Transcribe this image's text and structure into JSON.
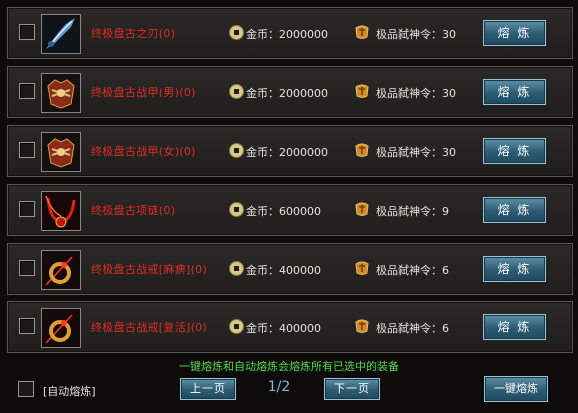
{
  "items": [
    {
      "name": "终极盘古之刃(0)",
      "gold_label": "金币：2000000",
      "token_label": "极品弑神令：30",
      "button_label": "熔 炼",
      "icon": "blue-blade-icon"
    },
    {
      "name": "终极盘古战甲(男)(0)",
      "gold_label": "金币：2000000",
      "token_label": "极品弑神令：30",
      "button_label": "熔 炼",
      "icon": "armor-male-icon"
    },
    {
      "name": "终极盘古战甲(女)(0)",
      "gold_label": "金币：2000000",
      "token_label": "极品弑神令：30",
      "button_label": "熔 炼",
      "icon": "armor-female-icon"
    },
    {
      "name": "终极盘古项链(0)",
      "gold_label": "金币：600000",
      "token_label": "极品弑神令：9",
      "button_label": "熔 炼",
      "icon": "necklace-icon"
    },
    {
      "name": "终极盘古战戒[麻痹](0)",
      "gold_label": "金币：400000",
      "token_label": "极品弑神令：6",
      "button_label": "熔 炼",
      "icon": "ring-paralysis-icon"
    },
    {
      "name": "终极盘古战戒[复活](0)",
      "gold_label": "金币：400000",
      "token_label": "极品弑神令：6",
      "button_label": "熔 炼",
      "icon": "ring-revive-icon"
    }
  ],
  "footer": {
    "hint": "一键熔炼和自动熔炼会熔炼所有已选中的装备",
    "auto_label": "[自动熔炼]",
    "prev_label": "上一页",
    "page_text": "1/2",
    "next_label": "下一页",
    "all_label": "一键熔炼"
  }
}
